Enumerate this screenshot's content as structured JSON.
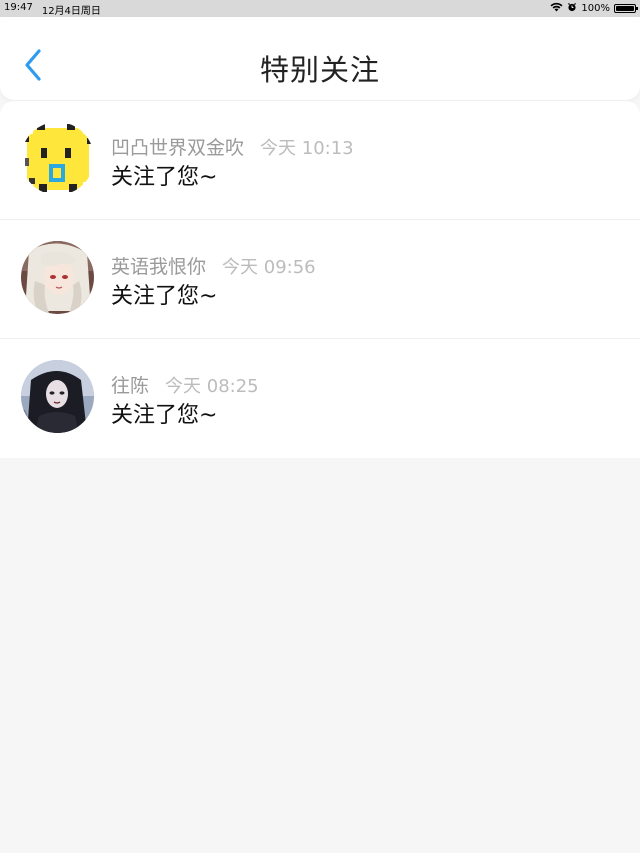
{
  "status_bar": {
    "time": "19:47",
    "date": "12月4日周日",
    "battery": "100%"
  },
  "header": {
    "title": "特别关注",
    "back_icon": "chevron-left-icon"
  },
  "colors": {
    "accent": "#2d9bf0",
    "background": "#f7f6f7",
    "card": "#ffffff"
  },
  "items": [
    {
      "name": "凹凸世界双金吹",
      "time": "今天 10:13",
      "message": "关注了您~"
    },
    {
      "name": "英语我恨你",
      "time": "今天 09:56",
      "message": "关注了您~"
    },
    {
      "name": "往陈",
      "time": "今天 08:25",
      "message": "关注了您~"
    }
  ]
}
